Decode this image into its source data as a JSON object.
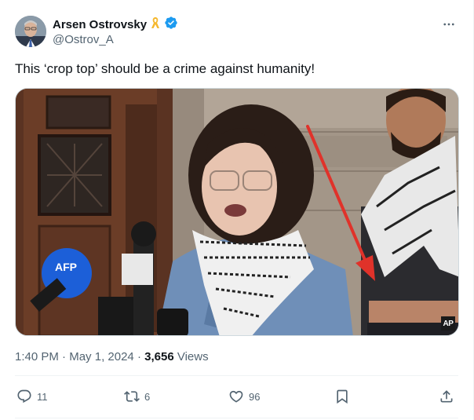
{
  "author": {
    "display_name": "Arsen Ostrovsky",
    "handle": "@Ostrov_A",
    "badge_icon": "yellow-ribbon-icon",
    "verified_icon": "verified-badge-icon",
    "verified_color": "#1d9bf0"
  },
  "tweet": {
    "text": "This ‘crop top’ should be a crime against humanity!"
  },
  "media": {
    "watermark": "AP",
    "mic_logo": "AFP"
  },
  "meta": {
    "time": "1:40 PM",
    "separator": "·",
    "date": "May 1, 2024",
    "views_count": "3,656",
    "views_label": "Views"
  },
  "actions": {
    "replies": "11",
    "reposts": "6",
    "likes": "96"
  },
  "colors": {
    "text_primary": "#0f1419",
    "text_secondary": "#536471",
    "accent": "#1d9bf0",
    "arrow": "#e0322a"
  }
}
